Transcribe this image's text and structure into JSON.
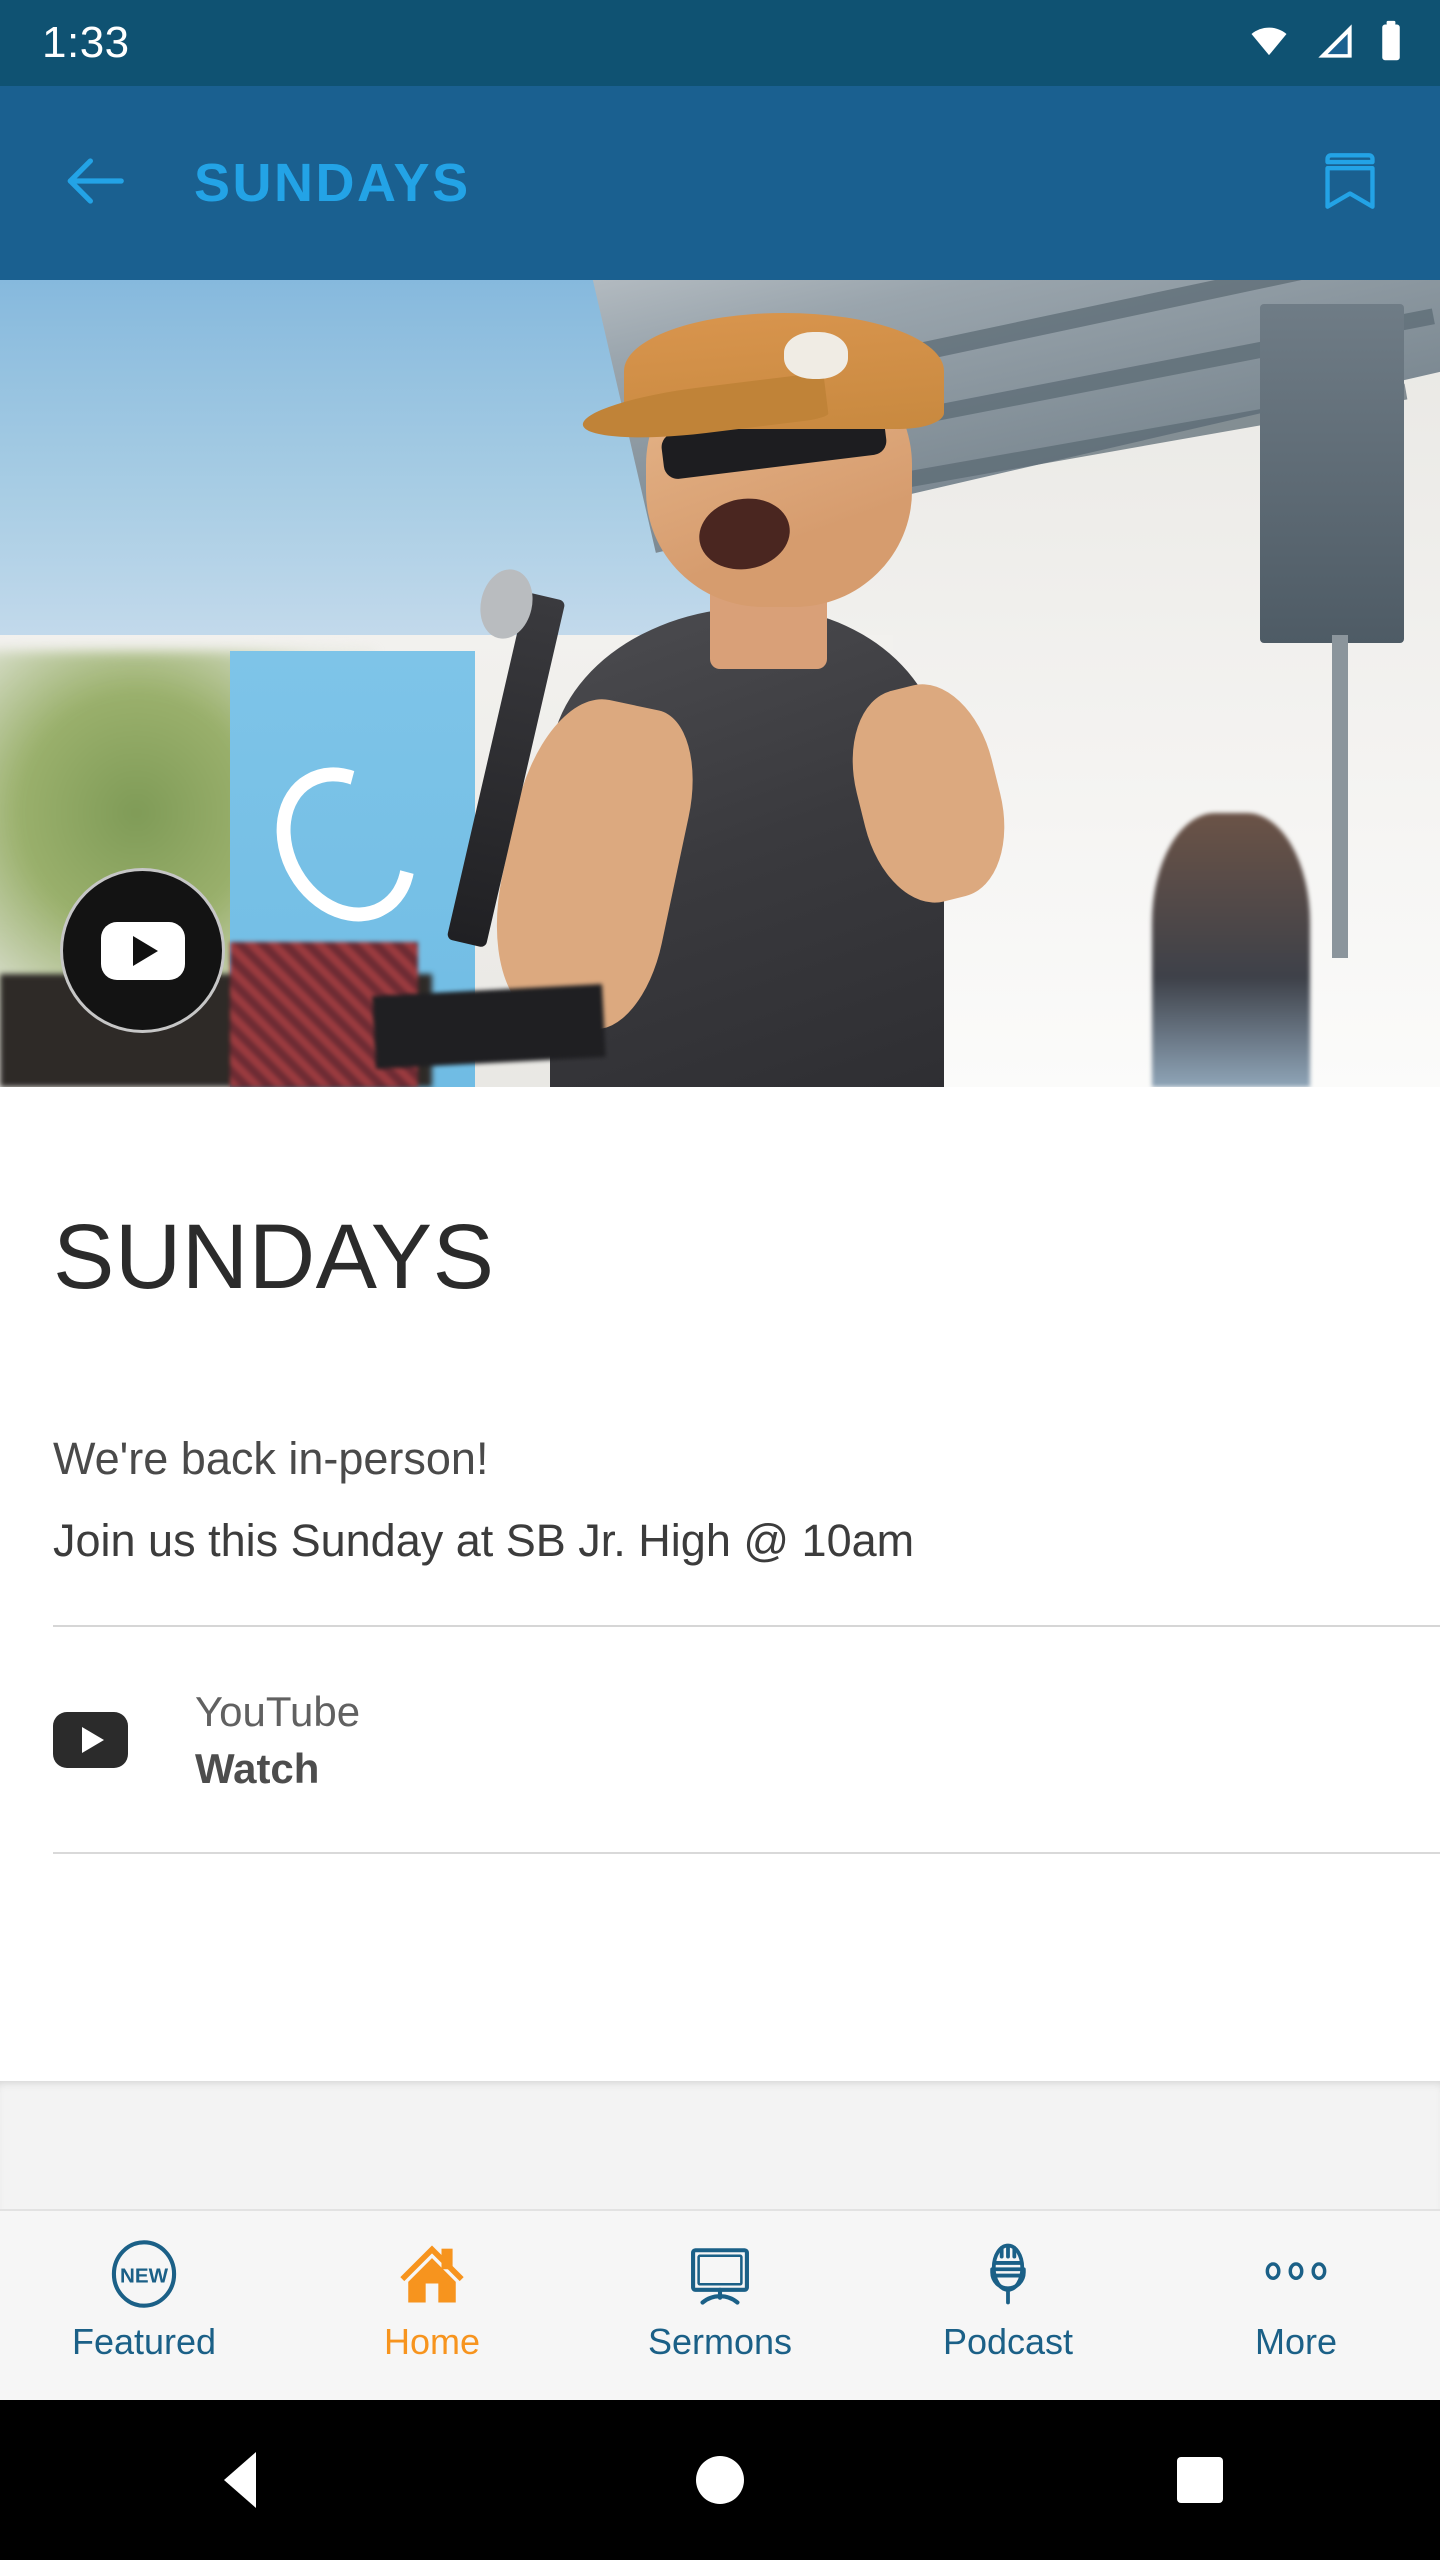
{
  "status_bar": {
    "time": "1:33",
    "icons": [
      "wifi-icon",
      "cellular-signal-icon",
      "battery-icon"
    ]
  },
  "app_bar": {
    "back_icon": "arrow-left-icon",
    "title": "SUNDAYS",
    "action_icon": "bookmark-icon",
    "background_color": "#1a6090",
    "title_color": "#23a3e6"
  },
  "hero": {
    "play_button_icon": "youtube-play-icon",
    "description": "Man in tan cap and sunglasses speaking into a handheld microphone outdoors under a patio roof, with a light blue Ocean banner behind him"
  },
  "main": {
    "page_title": "SUNDAYS",
    "paragraphs": [
      "We're back in-person!",
      "Join us this Sunday at SB Jr. High @ 10am"
    ],
    "link": {
      "icon": "youtube-icon",
      "primary": "YouTube",
      "secondary": "Watch"
    }
  },
  "bottom_nav": {
    "active_color": "#f7941e",
    "inactive_color": "#1b6087",
    "items": [
      {
        "label": "Featured",
        "icon": "new-badge-icon",
        "active": false,
        "badge_text": "NEW"
      },
      {
        "label": "Home",
        "icon": "home-icon",
        "active": true
      },
      {
        "label": "Sermons",
        "icon": "monitor-icon",
        "active": false
      },
      {
        "label": "Podcast",
        "icon": "microphone-icon",
        "active": false
      },
      {
        "label": "More",
        "icon": "three-dots-icon",
        "active": false
      }
    ]
  },
  "android_nav": {
    "back": "back-triangle-icon",
    "home": "home-circle-icon",
    "recents": "recents-square-icon"
  }
}
